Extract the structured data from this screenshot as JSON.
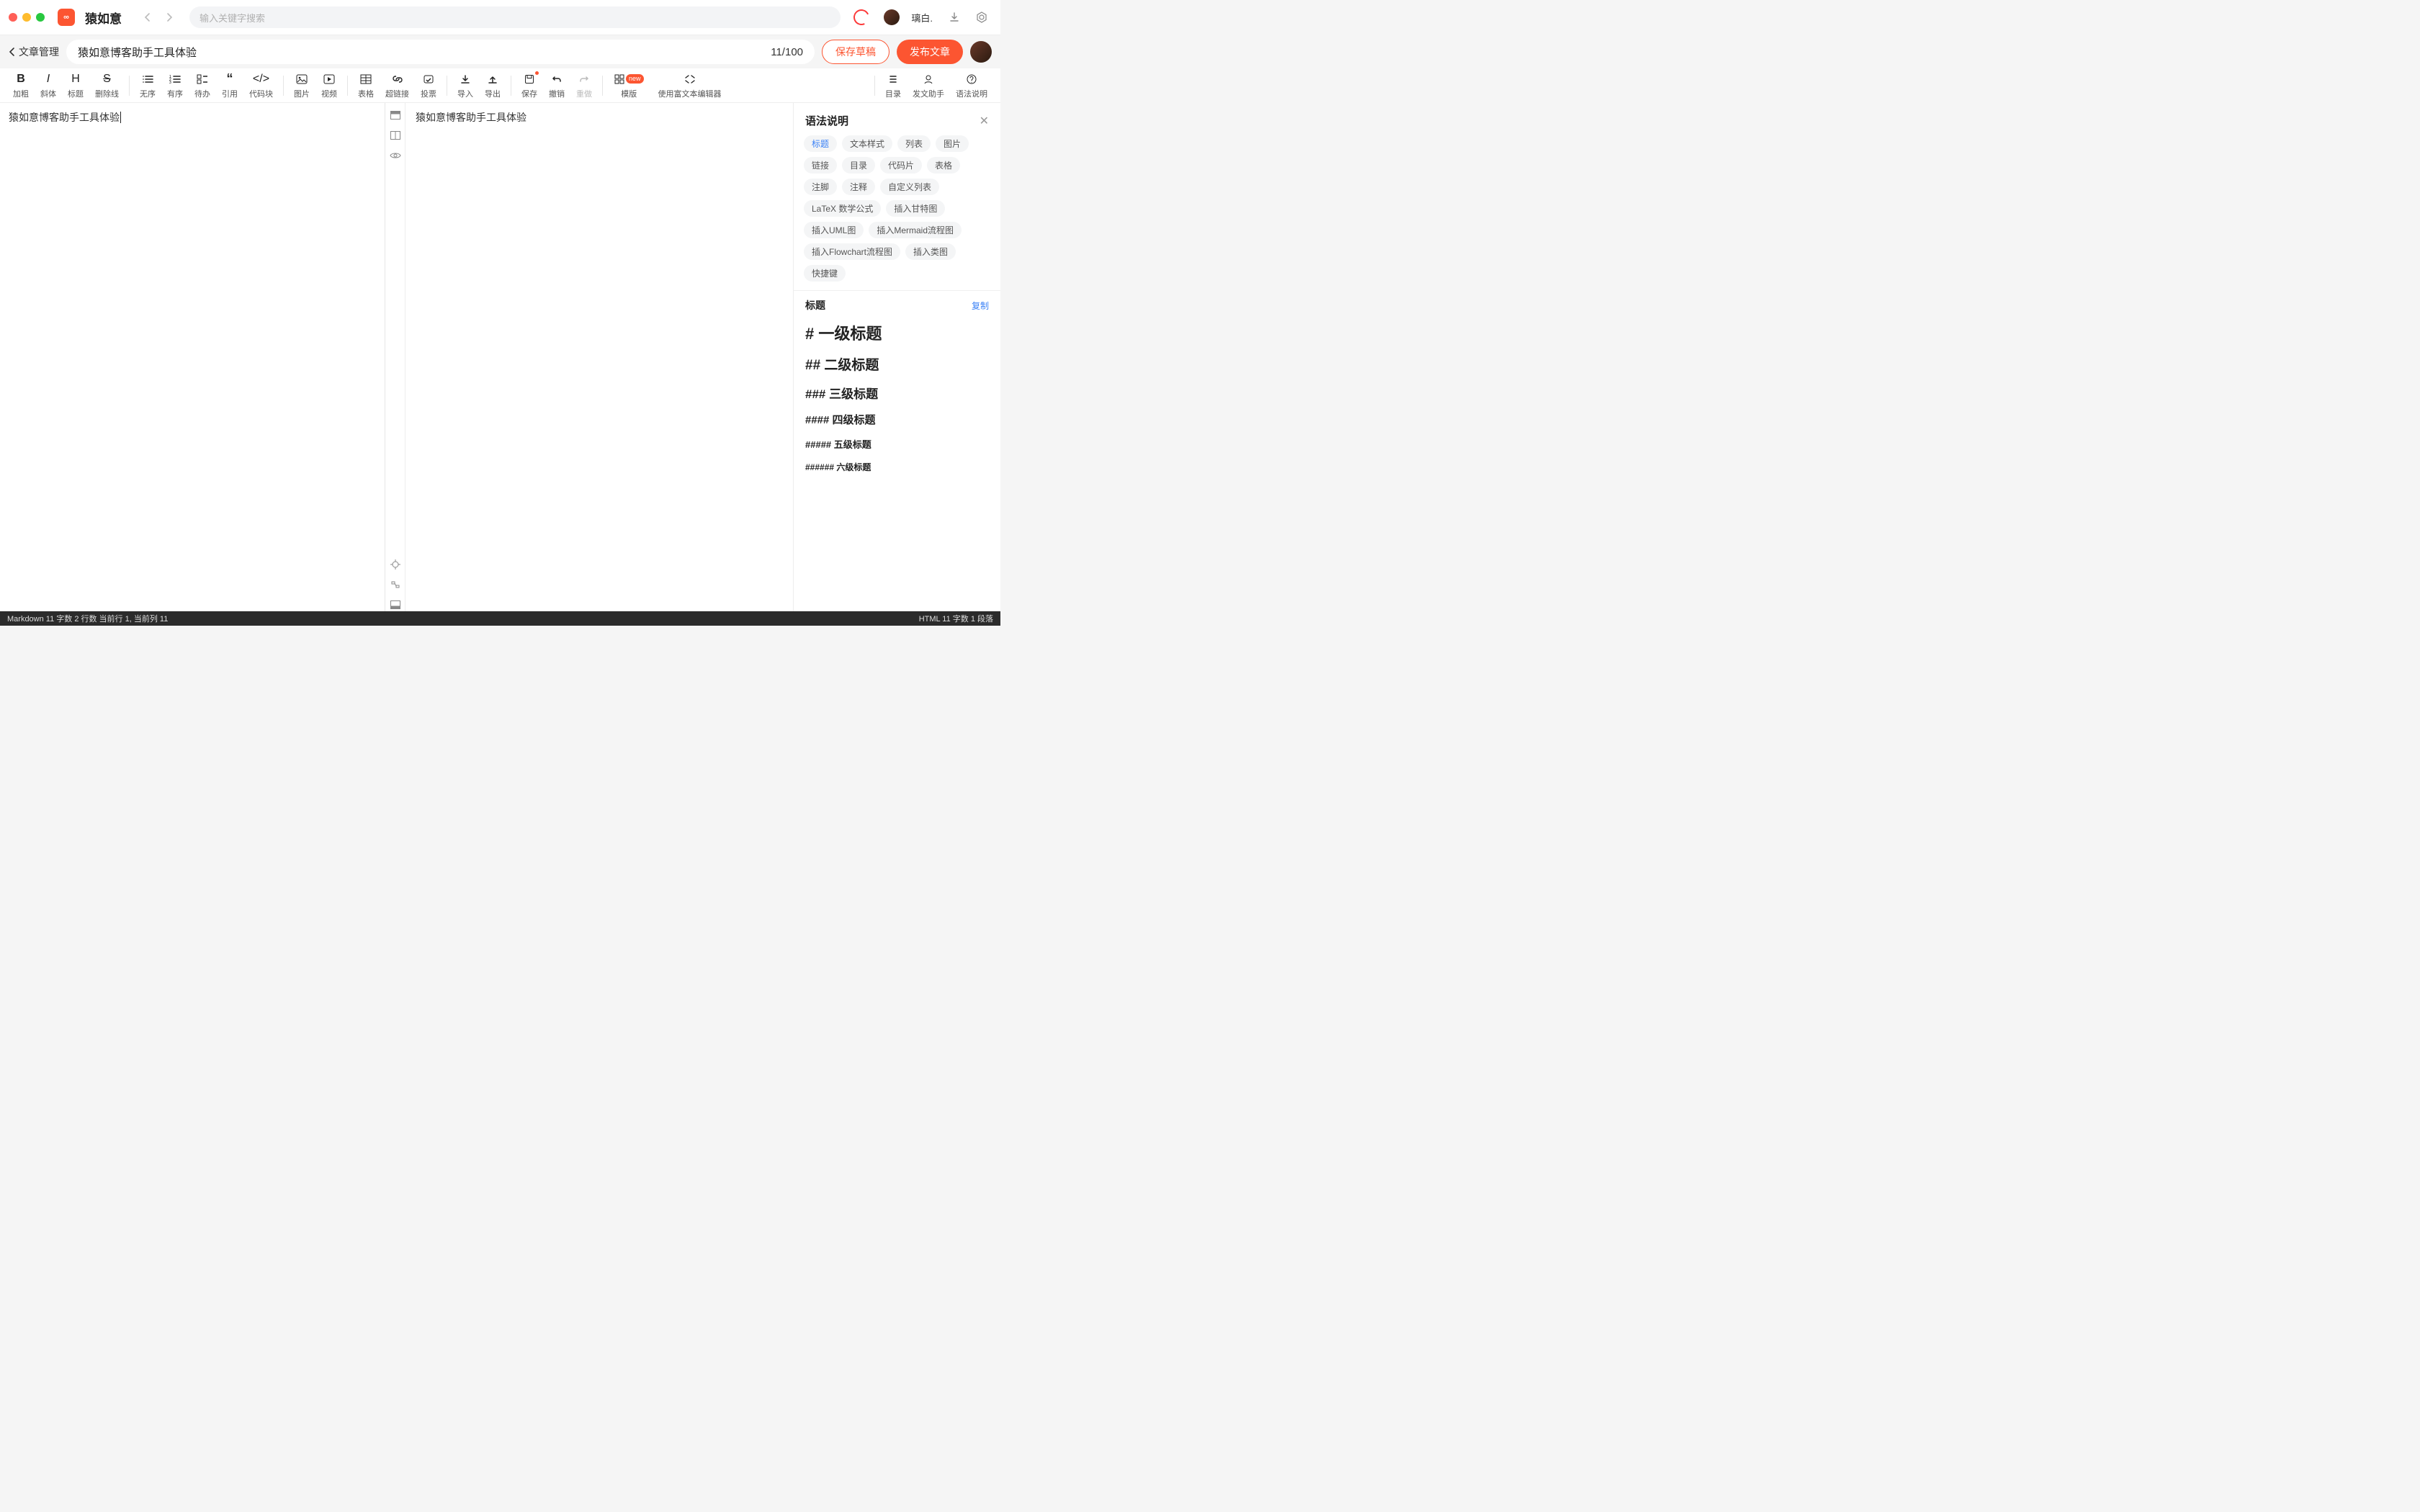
{
  "app": {
    "brand": "猿如意"
  },
  "search": {
    "placeholder": "输入关键字搜索"
  },
  "user": {
    "name": "璃白."
  },
  "titleRow": {
    "back": "文章管理",
    "title": "猿如意博客助手工具体验",
    "counter": "11/100",
    "saveDraft": "保存草稿",
    "publish": "发布文章"
  },
  "toolbar": {
    "groups": [
      [
        "加粗",
        "斜体",
        "标题",
        "删除线"
      ],
      [
        "无序",
        "有序",
        "待办",
        "引用",
        "代码块"
      ],
      [
        "图片",
        "视频"
      ],
      [
        "表格",
        "超链接",
        "投票"
      ],
      [
        "导入",
        "导出"
      ],
      [
        "保存",
        "撤销",
        "重做"
      ]
    ],
    "template": "模版",
    "newBadge": "new",
    "richtext": "使用富文本编辑器",
    "right": [
      "目录",
      "发文助手",
      "语法说明"
    ]
  },
  "editor": {
    "text": "猿如意博客助手工具体验"
  },
  "preview": {
    "text": "猿如意博客助手工具体验"
  },
  "rpanel": {
    "title": "语法说明",
    "chips": [
      "标题",
      "文本样式",
      "列表",
      "图片",
      "链接",
      "目录",
      "代码片",
      "表格",
      "注脚",
      "注释",
      "自定义列表",
      "LaTeX 数学公式",
      "插入甘特图",
      "插入UML图",
      "插入Mermaid流程图",
      "插入Flowchart流程图",
      "插入类图",
      "快捷键"
    ],
    "activeChip": 0,
    "section": {
      "heading": "标题",
      "copy": "复制",
      "items": [
        "# 一级标题",
        "## 二级标题",
        "### 三级标题",
        "#### 四级标题",
        "##### 五级标题",
        "###### 六级标题"
      ]
    }
  },
  "status": {
    "left": "Markdown   11 字数   2 行数   当前行 1, 当前列 11",
    "right": "HTML   11 字数   1 段落"
  }
}
